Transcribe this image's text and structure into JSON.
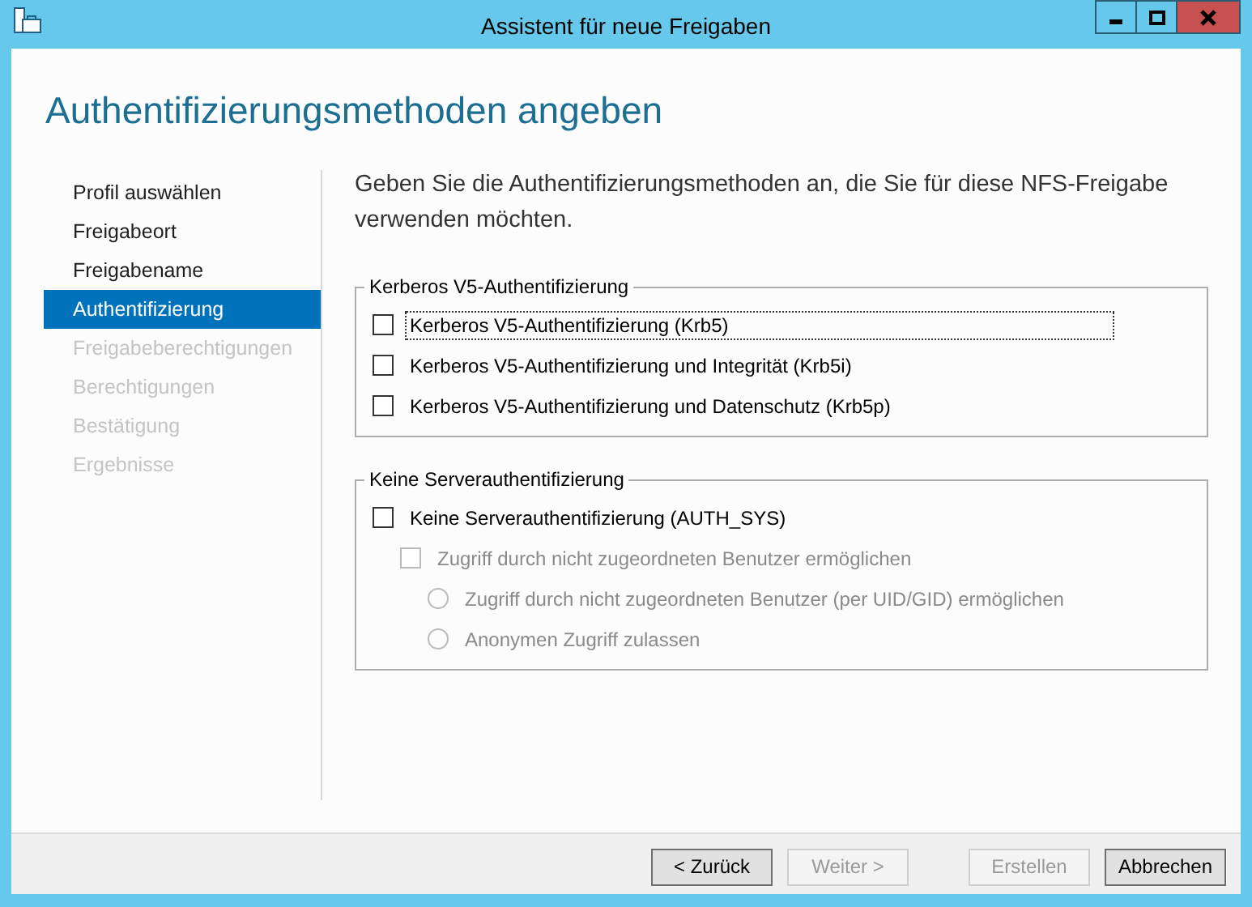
{
  "window": {
    "title": "Assistent für neue Freigaben"
  },
  "heading": "Authentifizierungsmethoden angeben",
  "steps": [
    {
      "label": "Profil auswählen",
      "selected": false,
      "disabled": false
    },
    {
      "label": "Freigabeort",
      "selected": false,
      "disabled": false
    },
    {
      "label": "Freigabename",
      "selected": false,
      "disabled": false
    },
    {
      "label": "Authentifizierung",
      "selected": true,
      "disabled": false
    },
    {
      "label": "Freigabeberechtigungen",
      "selected": false,
      "disabled": true
    },
    {
      "label": "Berechtigungen",
      "selected": false,
      "disabled": true
    },
    {
      "label": "Bestätigung",
      "selected": false,
      "disabled": true
    },
    {
      "label": "Ergebnisse",
      "selected": false,
      "disabled": true
    }
  ],
  "description": "Geben Sie die Authentifizierungsmethoden an, die Sie für diese NFS-Freigabe verwenden möchten.",
  "groups": [
    {
      "title": "Kerberos V5-Authentifizierung",
      "options": [
        {
          "kind": "checkbox",
          "label": "Kerberos V5-Authentifizierung (Krb5)",
          "checked": false,
          "disabled": false,
          "focused": true
        },
        {
          "kind": "checkbox",
          "label": "Kerberos V5-Authentifizierung und Integrität (Krb5i)",
          "checked": false,
          "disabled": false,
          "focused": false
        },
        {
          "kind": "checkbox",
          "label": "Kerberos V5-Authentifizierung und Datenschutz (Krb5p)",
          "checked": false,
          "disabled": false,
          "focused": false
        }
      ]
    },
    {
      "title": "Keine Serverauthentifizierung",
      "options": [
        {
          "kind": "checkbox",
          "label": "Keine Serverauthentifizierung (AUTH_SYS)",
          "checked": false,
          "disabled": false,
          "focused": false,
          "children": [
            {
              "kind": "checkbox",
              "label": "Zugriff durch nicht zugeordneten Benutzer ermöglichen",
              "checked": false,
              "disabled": true,
              "focused": false,
              "children": [
                {
                  "kind": "radio",
                  "label": "Zugriff durch nicht zugeordneten Benutzer (per UID/GID) ermöglichen",
                  "selected": false,
                  "disabled": true,
                  "focused": false
                },
                {
                  "kind": "radio",
                  "label": "Anonymen Zugriff zulassen",
                  "selected": false,
                  "disabled": true,
                  "focused": false
                }
              ]
            }
          ]
        }
      ]
    }
  ],
  "buttons": [
    {
      "label": "< Zurück",
      "disabled": false
    },
    {
      "label": "Weiter >",
      "disabled": true
    },
    {
      "label": "Erstellen",
      "disabled": true
    },
    {
      "label": "Abbrechen",
      "disabled": false
    }
  ]
}
